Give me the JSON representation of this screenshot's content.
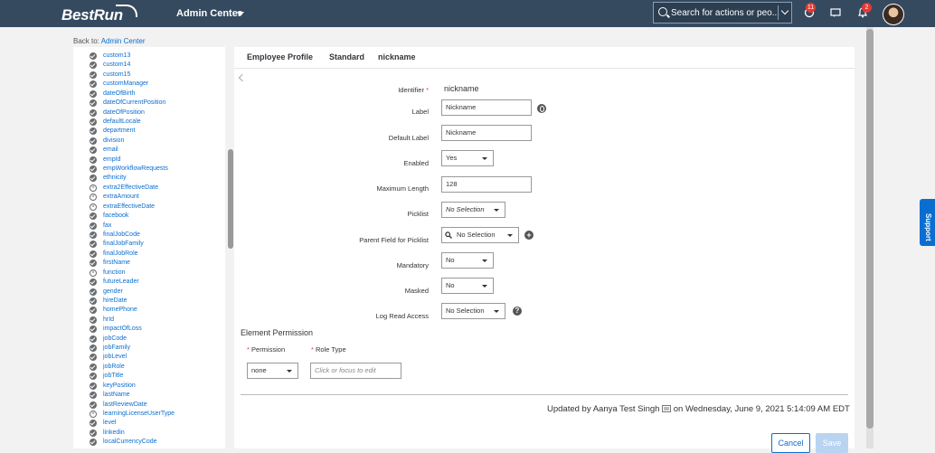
{
  "header": {
    "logo": "BestRun",
    "admin_center": "Admin Center",
    "search_placeholder": "Search for actions or peo...",
    "notif_badge_1": "11",
    "notif_badge_2": "2"
  },
  "back": {
    "prefix": "Back to:",
    "link": "Admin Center"
  },
  "left_fields": [
    {
      "label": "custom13",
      "status": "check"
    },
    {
      "label": "custom14",
      "status": "check"
    },
    {
      "label": "custom15",
      "status": "check"
    },
    {
      "label": "customManager",
      "status": "check"
    },
    {
      "label": "dateOfBirth",
      "status": "check"
    },
    {
      "label": "dateOfCurrentPosition",
      "status": "check"
    },
    {
      "label": "dateOfPosition",
      "status": "check"
    },
    {
      "label": "defaultLocale",
      "status": "check"
    },
    {
      "label": "department",
      "status": "check"
    },
    {
      "label": "division",
      "status": "check"
    },
    {
      "label": "email",
      "status": "check"
    },
    {
      "label": "empId",
      "status": "check"
    },
    {
      "label": "empWorkflowRequests",
      "status": "check"
    },
    {
      "label": "ethnicity",
      "status": "check"
    },
    {
      "label": "extra2EffectiveDate",
      "status": "x"
    },
    {
      "label": "extraAmount",
      "status": "x"
    },
    {
      "label": "extraEffectiveDate",
      "status": "x"
    },
    {
      "label": "facebook",
      "status": "check"
    },
    {
      "label": "fax",
      "status": "check"
    },
    {
      "label": "finalJobCode",
      "status": "check"
    },
    {
      "label": "finalJobFamily",
      "status": "check"
    },
    {
      "label": "finalJobRole",
      "status": "check"
    },
    {
      "label": "firstName",
      "status": "check"
    },
    {
      "label": "function",
      "status": "x"
    },
    {
      "label": "futureLeader",
      "status": "check"
    },
    {
      "label": "gender",
      "status": "check"
    },
    {
      "label": "hireDate",
      "status": "check"
    },
    {
      "label": "homePhone",
      "status": "check"
    },
    {
      "label": "hrId",
      "status": "check"
    },
    {
      "label": "impactOfLoss",
      "status": "check"
    },
    {
      "label": "jobCode",
      "status": "check"
    },
    {
      "label": "jobFamily",
      "status": "check"
    },
    {
      "label": "jobLevel",
      "status": "check"
    },
    {
      "label": "jobRole",
      "status": "check"
    },
    {
      "label": "jobTitle",
      "status": "check"
    },
    {
      "label": "keyPosition",
      "status": "check"
    },
    {
      "label": "lastName",
      "status": "check"
    },
    {
      "label": "lastReviewDate",
      "status": "check"
    },
    {
      "label": "learningLicenseUserType",
      "status": "x"
    },
    {
      "label": "level",
      "status": "check"
    },
    {
      "label": "linkedin",
      "status": "check"
    },
    {
      "label": "localCurrencyCode",
      "status": "check"
    }
  ],
  "tabs": [
    "Employee Profile",
    "Standard",
    "nickname"
  ],
  "form": {
    "identifier_label": "Identifier",
    "identifier_value": "nickname",
    "label_label": "Label",
    "label_value": "Nickname",
    "default_label_label": "Default Label",
    "default_label_value": "Nickname",
    "enabled_label": "Enabled",
    "enabled_value": "Yes",
    "max_length_label": "Maximum Length",
    "max_length_value": "128",
    "picklist_label": "Picklist",
    "picklist_value": "No Selection",
    "parent_field_label": "Parent Field for Picklist",
    "parent_field_value": "No Selection",
    "mandatory_label": "Mandatory",
    "mandatory_value": "No",
    "masked_label": "Masked",
    "masked_value": "No",
    "log_read_label": "Log Read Access",
    "log_read_value": "No Selection"
  },
  "permission": {
    "title": "Element Permission",
    "permission_label": "Permission",
    "role_type_label": "Role Type",
    "permission_value": "none",
    "role_type_placeholder": "Click or focus to edit"
  },
  "footer": {
    "updated_text": "Updated by Aanya Test Singh",
    "updated_date": "on Wednesday, June 9, 2021 5:14:09 AM EDT",
    "cancel": "Cancel",
    "save": "Save"
  },
  "support": "Support",
  "colors": {
    "topbar": "#354a5f",
    "link": "#0a6ed1",
    "save_disabled": "#b8d4f1"
  }
}
